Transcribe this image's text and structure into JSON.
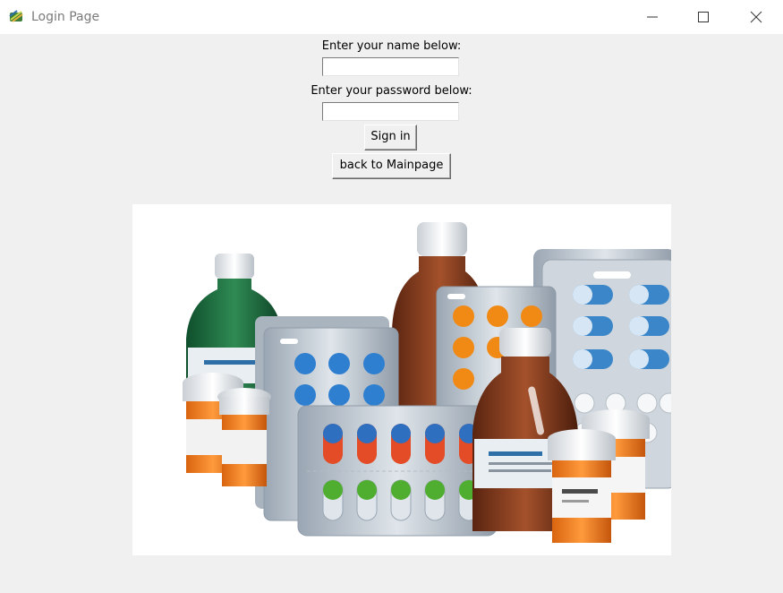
{
  "window": {
    "title": "Login Page",
    "icon": "tk-feather-icon"
  },
  "form": {
    "name_label": "Enter your name below:",
    "name_value": "",
    "password_label": "Enter your password below:",
    "password_value": "",
    "sign_in_label": "Sign in",
    "back_label": "back to Mainpage"
  },
  "image": {
    "subject": "medicine bottles and pill blister packs"
  },
  "colors": {
    "window_bg": "#f0f0f0",
    "titlebar_bg": "#ffffff"
  }
}
